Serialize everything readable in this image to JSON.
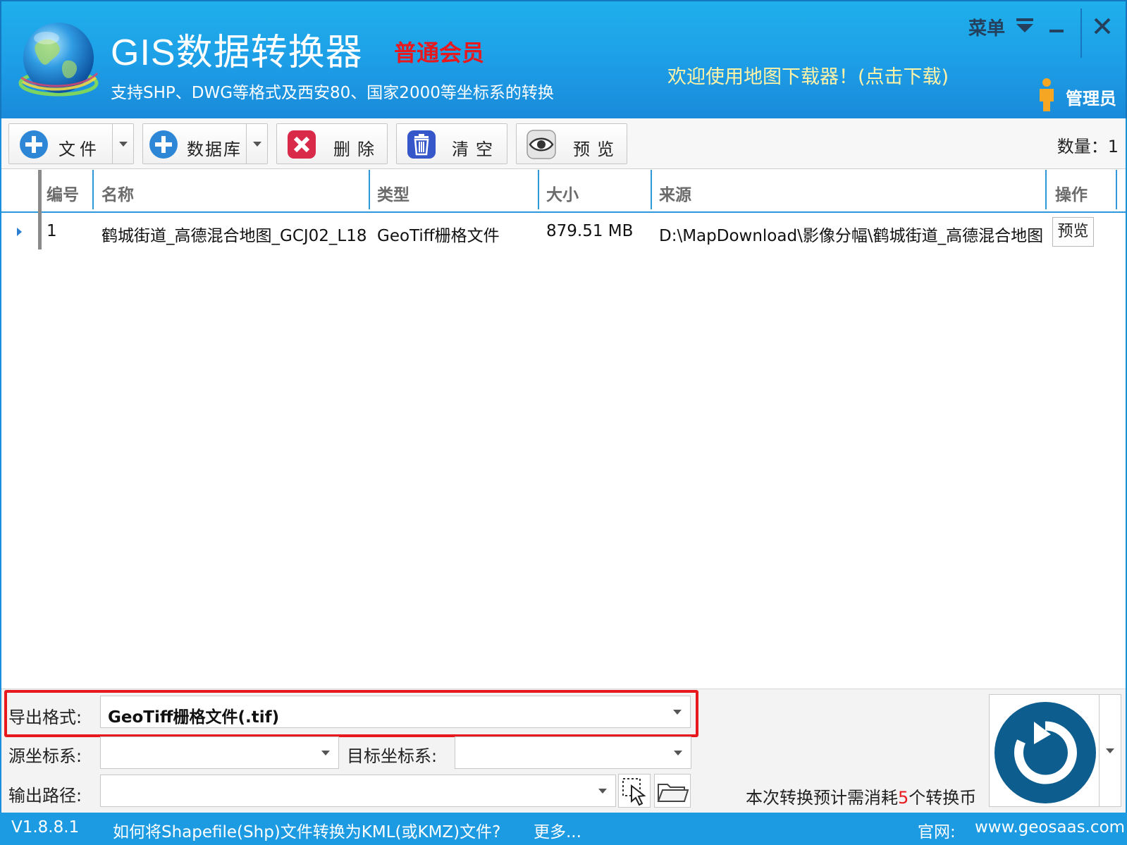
{
  "header": {
    "app_title": "GIS数据转换器",
    "membership": "普通会员",
    "subtitle": "支持SHP、DWG等格式及西安80、国家2000等坐标系的转换",
    "welcome_link": "欢迎使用地图下载器！(点击下载)",
    "menu_label": "菜单",
    "user_label": "管理员",
    "icons": [
      "globe-logo-icon",
      "menu-dropdown-icon",
      "minimize-icon",
      "close-icon",
      "user-icon"
    ]
  },
  "toolbar": {
    "file_label": "文件",
    "database_label": "数据库",
    "delete_label": "删除",
    "clear_label": "清空",
    "preview_label": "预览",
    "count_text": "数量：1",
    "icons": [
      "add-file-icon",
      "add-database-icon",
      "delete-icon",
      "trash-icon",
      "eye-icon"
    ]
  },
  "table": {
    "columns": [
      "编号",
      "名称",
      "类型",
      "大小",
      "来源",
      "操作"
    ],
    "rows": [
      {
        "no": "1",
        "name": "鹤城街道_高德混合地图_GCJ02_L18",
        "type": "GeoTiff栅格文件",
        "size": "879.51 MB",
        "source": "D:\\MapDownload\\影像分幅\\鹤城街道_高德混合地图",
        "action": "预览"
      }
    ]
  },
  "panel": {
    "export_format_label": "导出格式:",
    "export_format_value": "GeoTiff栅格文件(.tif)",
    "source_crs_label": "源坐标系:",
    "source_crs_value": "",
    "target_crs_label": "目标坐标系:",
    "target_crs_value": "",
    "output_path_label": "输出路径:",
    "output_path_value": "",
    "cost_prefix": "本次转换预计需消耗",
    "cost_amount": "5",
    "cost_suffix": "个转换币"
  },
  "status": {
    "version": "V1.8.8.1",
    "help_link": "如何将Shapefile(Shp)文件转换为KML(或KMZ)文件?",
    "more_link": "更多...",
    "site_label": "官网:",
    "site_url": "www.geosaas.com"
  },
  "colors": {
    "header_blue": "#1d9de6",
    "status_blue": "#1c9be3",
    "member_red": "#e8191e",
    "highlight_red": "#e8191e",
    "welcome_yellow": "#fff3a8",
    "convert_button": "#0e5d8f"
  }
}
